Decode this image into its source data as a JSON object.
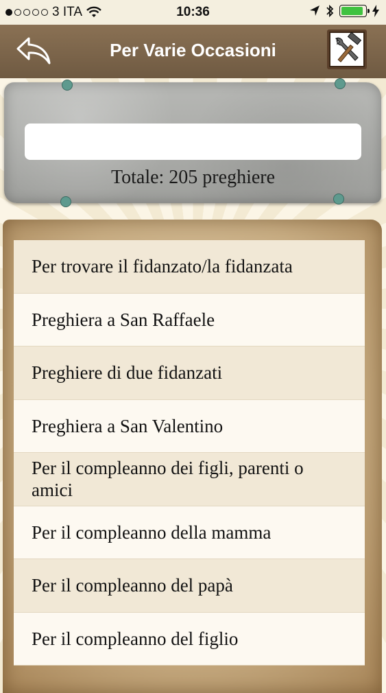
{
  "status_bar": {
    "carrier": "3 ITA",
    "time": "10:36",
    "battery_percent": 90
  },
  "nav": {
    "title": "Per Varie Occasioni",
    "back_icon": "back-arrow-icon",
    "tools_icon": "hammer-wrench-icon"
  },
  "search": {
    "value": "",
    "placeholder": ""
  },
  "total_label": "Totale: 205 preghiere",
  "prayers": [
    "Per trovare il fidanzato/la fidanzata",
    "Preghiera a San Raffaele",
    "Preghiere di due fidanzati",
    "Preghiera a San Valentino",
    "Per il compleanno dei figli, parenti o amici",
    "Per il compleanno della mamma",
    "Per il compleanno del papà",
    "Per il compleanno del figlio"
  ],
  "colors": {
    "nav_bar": "#7d6549",
    "battery": "#3fc23f",
    "row_odd": "#f1e8d6",
    "row_even": "#fdf9f1"
  }
}
